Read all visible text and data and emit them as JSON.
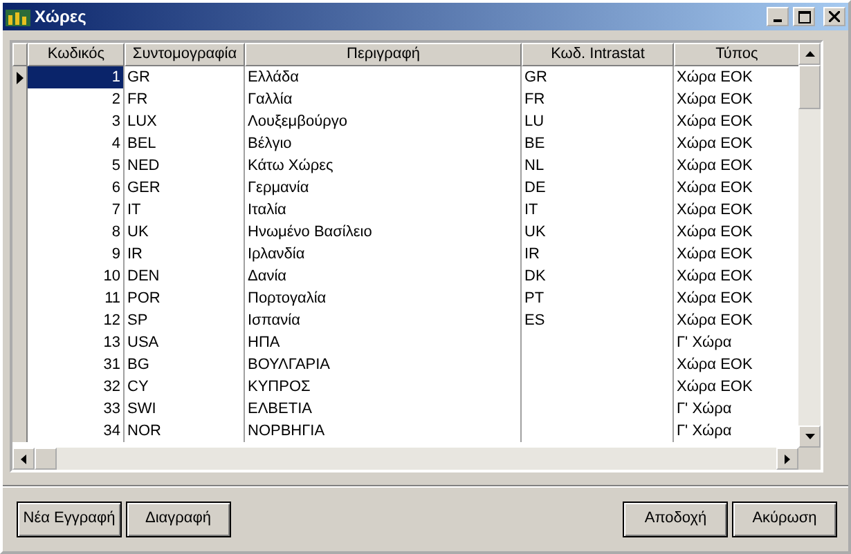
{
  "window": {
    "title": "Χώρες"
  },
  "table": {
    "columns": [
      "Κωδικός",
      "Συντομογραφία",
      "Περιγραφή",
      "Κωδ. Intrastat",
      "Τύπος"
    ],
    "rows": [
      {
        "selected": true,
        "cells": [
          "1",
          "GR",
          "Ελλάδα",
          "GR",
          "Χώρα ΕΟΚ"
        ]
      },
      {
        "selected": false,
        "cells": [
          "2",
          "FR",
          "Γαλλία",
          "FR",
          "Χώρα ΕΟΚ"
        ]
      },
      {
        "selected": false,
        "cells": [
          "3",
          "LUX",
          "Λουξεμβούργο",
          "LU",
          "Χώρα ΕΟΚ"
        ]
      },
      {
        "selected": false,
        "cells": [
          "4",
          "BEL",
          "Βέλγιο",
          "BE",
          "Χώρα ΕΟΚ"
        ]
      },
      {
        "selected": false,
        "cells": [
          "5",
          "NED",
          "Κάτω Χώρες",
          "NL",
          "Χώρα ΕΟΚ"
        ]
      },
      {
        "selected": false,
        "cells": [
          "6",
          "GER",
          "Γερμανία",
          "DE",
          "Χώρα ΕΟΚ"
        ]
      },
      {
        "selected": false,
        "cells": [
          "7",
          "IT",
          "Ιταλία",
          "IT",
          "Χώρα ΕΟΚ"
        ]
      },
      {
        "selected": false,
        "cells": [
          "8",
          "UK",
          "Ηνωμένο Βασίλειο",
          "UK",
          "Χώρα ΕΟΚ"
        ]
      },
      {
        "selected": false,
        "cells": [
          "9",
          "IR",
          "Ιρλανδία",
          "IR",
          "Χώρα ΕΟΚ"
        ]
      },
      {
        "selected": false,
        "cells": [
          "10",
          "DEN",
          "Δανία",
          "DK",
          "Χώρα ΕΟΚ"
        ]
      },
      {
        "selected": false,
        "cells": [
          "11",
          "POR",
          "Πορτογαλία",
          "PT",
          "Χώρα ΕΟΚ"
        ]
      },
      {
        "selected": false,
        "cells": [
          "12",
          "SP",
          "Ισπανία",
          "ES",
          "Χώρα ΕΟΚ"
        ]
      },
      {
        "selected": false,
        "cells": [
          "13",
          "USA",
          "ΗΠΑ",
          "",
          "Γ' Χώρα"
        ]
      },
      {
        "selected": false,
        "cells": [
          "31",
          "BG",
          "ΒΟΥΛΓΑΡΙΑ",
          "",
          "Χώρα ΕΟΚ"
        ]
      },
      {
        "selected": false,
        "cells": [
          "32",
          "CY",
          "ΚΥΠΡΟΣ",
          "",
          "Χώρα ΕΟΚ"
        ]
      },
      {
        "selected": false,
        "cells": [
          "33",
          "SWI",
          "ΕΛΒΕΤΙΑ",
          "",
          "Γ' Χώρα"
        ]
      },
      {
        "selected": false,
        "cells": [
          "34",
          "NOR",
          "ΝΟΡΒΗΓΙΑ",
          "",
          "Γ' Χώρα"
        ]
      }
    ]
  },
  "buttons_left": [
    "Νέα Εγγραφή",
    "Διαγραφή"
  ],
  "buttons_right": [
    "Αποδοχή",
    "Ακύρωση"
  ]
}
